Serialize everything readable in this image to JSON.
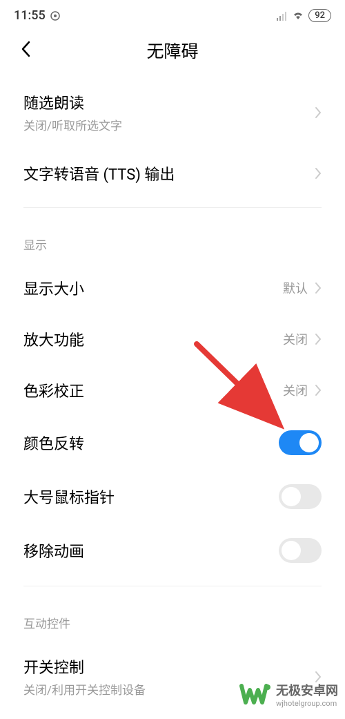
{
  "statusBar": {
    "time": "11:55",
    "battery": "92"
  },
  "nav": {
    "title": "无障碍"
  },
  "items": {
    "selectToSpeak": {
      "title": "随选朗读",
      "subtitle": "关闭/听取所选文字"
    },
    "tts": {
      "title": "文字转语音 (TTS) 输出"
    }
  },
  "sections": {
    "display": "显示",
    "interaction": "互动控件"
  },
  "displayItems": {
    "displaySize": {
      "title": "显示大小",
      "value": "默认"
    },
    "magnify": {
      "title": "放大功能",
      "value": "关闭"
    },
    "colorCorrection": {
      "title": "色彩校正",
      "value": "关闭"
    },
    "colorInversion": {
      "title": "颜色反转"
    },
    "largeCursor": {
      "title": "大号鼠标指针"
    },
    "removeAnimation": {
      "title": "移除动画"
    }
  },
  "interactionItems": {
    "switchControl": {
      "title": "开关控制",
      "subtitle": "关闭/利用开关控制设备"
    }
  },
  "watermark": {
    "title": "无极安卓网",
    "url": "wjhotelgroup.com"
  }
}
